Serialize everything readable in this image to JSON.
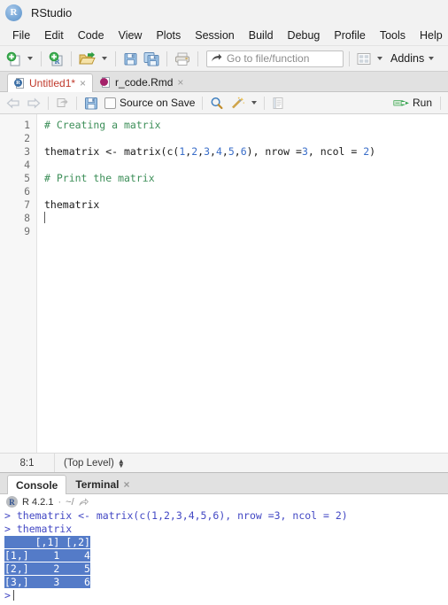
{
  "window": {
    "app_title": "RStudio",
    "app_logo_letter": "R"
  },
  "menubar": {
    "items": [
      {
        "label": "File"
      },
      {
        "label": "Edit"
      },
      {
        "label": "Code"
      },
      {
        "label": "View"
      },
      {
        "label": "Plots"
      },
      {
        "label": "Session"
      },
      {
        "label": "Build"
      },
      {
        "label": "Debug"
      },
      {
        "label": "Profile"
      },
      {
        "label": "Tools"
      },
      {
        "label": "Help"
      }
    ]
  },
  "toolbar": {
    "new_file_icon": "new-file-icon",
    "new_project_icon": "new-project-icon",
    "open_file_icon": "open-folder-icon",
    "save_icon": "save-icon",
    "save_all_icon": "save-all-icon",
    "print_icon": "print-icon",
    "goto_icon": "goto-arrow-icon",
    "goto_placeholder": "Go to file/function",
    "workspace_panes_icon": "workspace-panes-icon",
    "addins_label": "Addins"
  },
  "source": {
    "tabs": [
      {
        "label": "Untitled1*",
        "icon": "r-script-icon",
        "active": true,
        "modified": true
      },
      {
        "label": "r_code.Rmd",
        "icon": "rmarkdown-icon",
        "active": false,
        "modified": false
      }
    ],
    "tab_close_glyph": "×",
    "editor_toolbar": {
      "back_icon": "back-arrow-icon",
      "forward_icon": "forward-arrow-icon",
      "popout_icon": "show-in-new-window-icon",
      "save_icon": "save-icon",
      "source_on_save_label": "Source on Save",
      "find_icon": "magnifier-icon",
      "code_tools_icon": "magic-wand-icon",
      "compile_report_icon": "compile-report-icon",
      "run_label": "Run",
      "run_icon": "run-icon"
    },
    "line_numbers": [
      "1",
      "2",
      "3",
      "4",
      "5",
      "6",
      "7",
      "8",
      "9"
    ],
    "code_lines": [
      {
        "n": 1,
        "type": "comment",
        "text": "# Creating a matrix"
      },
      {
        "n": 2,
        "type": "blank",
        "text": ""
      },
      {
        "n": 3,
        "type": "code",
        "text": "thematrix <- matrix(c(1,2,3,4,5,6), nrow =3, ncol = 2)"
      },
      {
        "n": 4,
        "type": "blank",
        "text": ""
      },
      {
        "n": 5,
        "type": "comment",
        "text": "# Print the matrix"
      },
      {
        "n": 6,
        "type": "blank",
        "text": ""
      },
      {
        "n": 7,
        "type": "code",
        "text": "thematrix"
      },
      {
        "n": 8,
        "type": "cursor",
        "text": ""
      },
      {
        "n": 9,
        "type": "blank",
        "text": ""
      }
    ],
    "code_line3_parts": {
      "pre": "thematrix <- matrix(c(",
      "n1": "1",
      "c1": ",",
      "n2": "2",
      "c2": ",",
      "n3": "3",
      "c3": ",",
      "n4": "4",
      "c4": ",",
      "n5": "5",
      "c5": ",",
      "n6": "6",
      "mid": "), nrow =",
      "nrow": "3",
      "mid2": ", ncol = ",
      "ncol": "2",
      "post": ")"
    },
    "status": {
      "position": "8:1",
      "scope": "(Top Level)"
    }
  },
  "console": {
    "tabs": [
      {
        "label": "Console",
        "active": true,
        "closable": false
      },
      {
        "label": "Terminal",
        "active": false,
        "closable": true
      }
    ],
    "tab_close_glyph": "×",
    "logo_letter": "R",
    "version": "R 4.2.1",
    "separator": "·",
    "path": "~/",
    "path_icon": "open-in-new-icon",
    "lines": [
      {
        "kind": "input",
        "text": "> thematrix <- matrix(c(1,2,3,4,5,6), nrow =3, ncol = 2)"
      },
      {
        "kind": "input",
        "text": "> thematrix"
      }
    ],
    "output_matrix": {
      "header": "     [,1] [,2]",
      "rows": [
        "[1,]    1    4",
        "[2,]    2    5",
        "[3,]    3    6"
      ],
      "selected": true
    },
    "prompt": ">"
  },
  "colors": {
    "selection_blue": "#547bc8",
    "console_input": "#4348c4",
    "comment_green": "#3d8f59",
    "number_blue": "#3a6ec9",
    "modified_tab_red": "#c0392b",
    "run_green": "#3aa84a"
  }
}
